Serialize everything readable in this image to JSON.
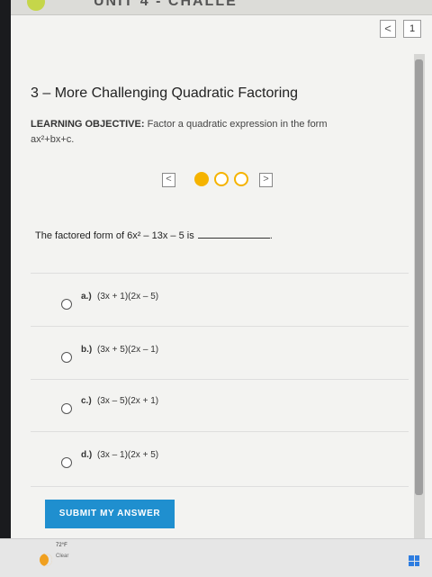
{
  "app": {
    "unit_title": "UNIT 4 - CHALLE"
  },
  "nav": {
    "prev_symbol": "<",
    "page_number": "1"
  },
  "lesson": {
    "title": "3 – More Challenging Quadratic Factoring",
    "objective_label": "LEARNING OBJECTIVE:",
    "objective_text": "Factor a quadratic expression in the form",
    "objective_formula": "ax²+bx+c."
  },
  "carousel": {
    "prev_symbol": "<",
    "next_symbol": ">",
    "dots": [
      "active",
      "empty",
      "empty"
    ]
  },
  "question": {
    "prefix": "The factored form of 6x² – 13x – 5 is",
    "suffix": "."
  },
  "options": [
    {
      "letter": "a.)",
      "text": "(3x + 1)(2x – 5)"
    },
    {
      "letter": "b.)",
      "text": "(3x + 5)(2x – 1)"
    },
    {
      "letter": "c.)",
      "text": "(3x – 5)(2x + 1)"
    },
    {
      "letter": "d.)",
      "text": "(3x – 1)(2x + 5)"
    }
  ],
  "submit_label": "SUBMIT MY ANSWER",
  "taskbar": {
    "weather_temp": "72°F",
    "weather_condition": "Clear"
  },
  "colors": {
    "accent": "#1f8fcf",
    "dot": "#f5b300"
  }
}
